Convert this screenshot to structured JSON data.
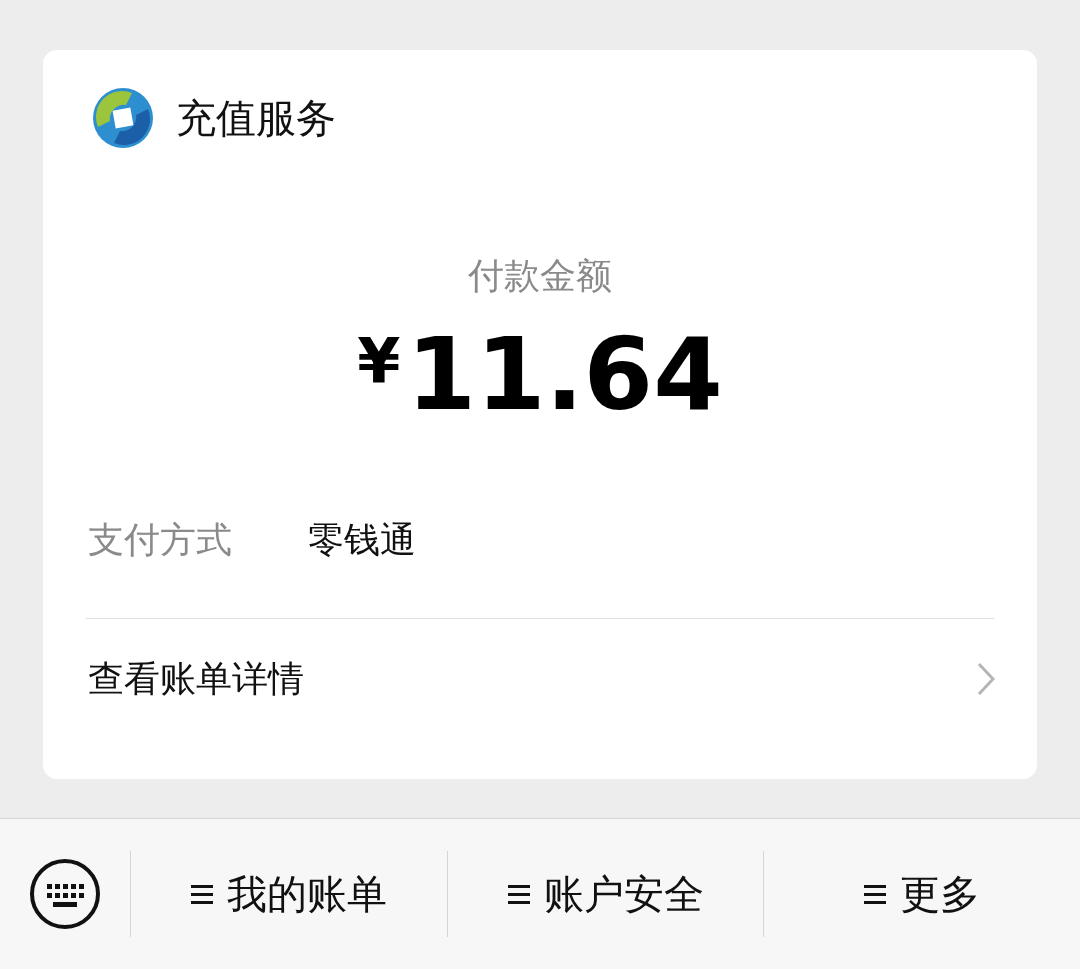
{
  "card": {
    "title": "充值服务",
    "amount_label": "付款金额",
    "currency": "¥",
    "amount": "11.64",
    "fields": [
      {
        "label": "支付方式",
        "value": "零钱通"
      }
    ],
    "link": "查看账单详情"
  },
  "menu_bar": {
    "items": [
      {
        "label": "我的账单"
      },
      {
        "label": "账户安全"
      },
      {
        "label": "更多"
      }
    ]
  }
}
